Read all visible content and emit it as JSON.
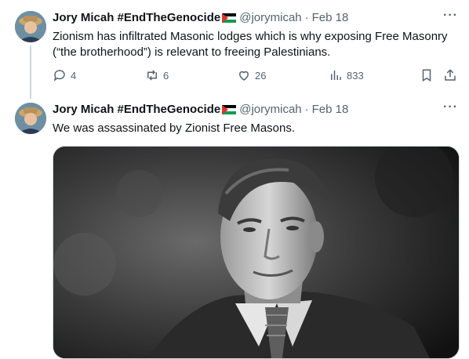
{
  "tweets": [
    {
      "author_name": "Jory Micah #EndTheGenocide",
      "handle": "@jorymicah",
      "separator": "·",
      "date": "Feb 18",
      "text_line1": "Zionism has infiltrated Masonic lodges which is why exposing Free Masonry",
      "text_line2": "(“the brotherhood”) is relevant to freeing Palestinians.",
      "replies": "4",
      "retweets": "6",
      "likes": "26",
      "views": "833"
    },
    {
      "author_name": "Jory Micah #EndTheGenocide",
      "handle": "@jorymicah",
      "separator": "·",
      "date": "Feb 18",
      "text_line1": "We was assassinated by Zionist Free Masons."
    }
  ],
  "icons": {
    "more": "more-icon",
    "reply": "reply-icon",
    "retweet": "retweet-icon",
    "like": "heart-icon",
    "views": "views-icon",
    "bookmark": "bookmark-icon",
    "share": "share-icon",
    "flag": "palestine-flag-icon"
  },
  "colors": {
    "text": "#0f1419",
    "secondary": "#536471",
    "thread_line": "#cfd9de"
  }
}
